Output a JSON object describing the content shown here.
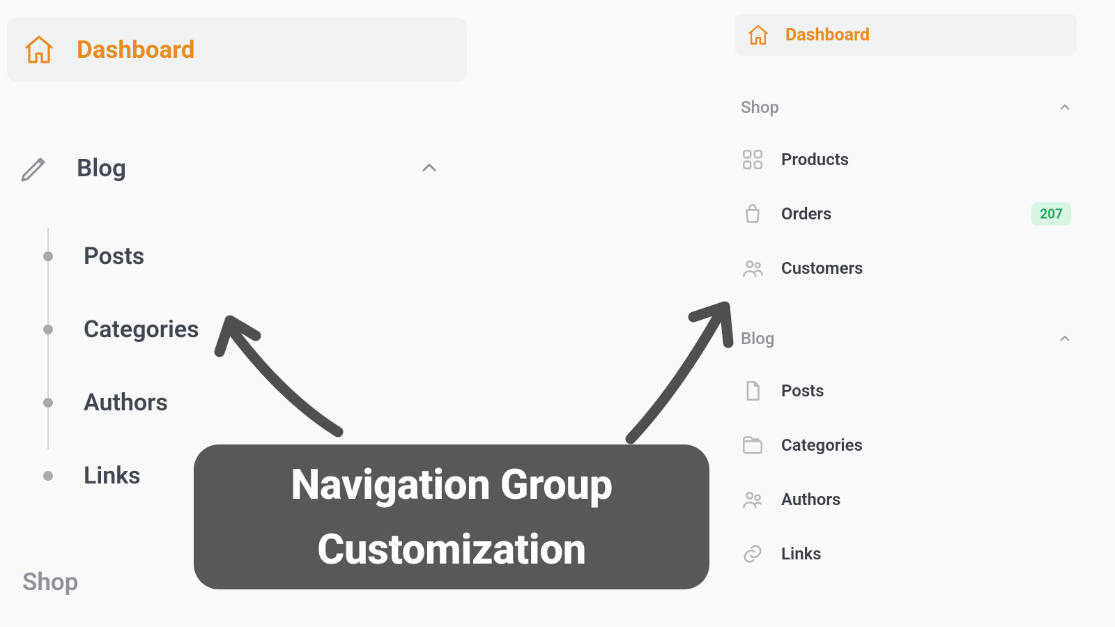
{
  "left": {
    "dashboard_label": "Dashboard",
    "blog_label": "Blog",
    "tree": {
      "posts": "Posts",
      "categories": "Categories",
      "authors": "Authors",
      "links": "Links"
    },
    "shop_label": "Shop"
  },
  "right": {
    "dashboard_label": "Dashboard",
    "shop_group": "Shop",
    "blog_group": "Blog",
    "items": {
      "products": "Products",
      "orders": "Orders",
      "customers": "Customers",
      "posts": "Posts",
      "categories": "Categories",
      "authors": "Authors",
      "links": "Links"
    },
    "orders_badge": "207"
  },
  "callout": {
    "line1": "Navigation Group",
    "line2": "Customization"
  }
}
